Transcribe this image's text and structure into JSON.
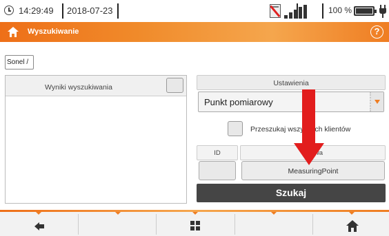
{
  "status_bar": {
    "time": "14:29:49",
    "date": "2018-07-23",
    "battery_percent": "100 %",
    "battery_level": 1.0,
    "icons": [
      "clock-icon",
      "sd-card-disabled-icon",
      "signal-strength-icon",
      "battery-icon",
      "power-plug-icon"
    ]
  },
  "title_bar": {
    "title": "Wyszukiwanie",
    "help_label": "?"
  },
  "breadcrumb": "Sonel /",
  "results": {
    "header": "Wyniki wyszukiwania",
    "items": []
  },
  "settings": {
    "header": "Ustawienia",
    "selected_option": "Punkt pomiarowy",
    "search_all_clients_label": "Przeszukaj wszystkich klientów",
    "id_label": "ID",
    "name_label": "Nazwa",
    "id_value": "",
    "name_value": "MeasuringPoint",
    "search_button": "Szukaj"
  },
  "toolbar": {
    "buttons": [
      "back-arrow-icon",
      "",
      "grid-icon",
      "",
      "home-icon"
    ]
  },
  "colors": {
    "accent": "#ef7d22",
    "annotation_arrow": "#e21d1d",
    "search_button_bg": "#454545"
  }
}
